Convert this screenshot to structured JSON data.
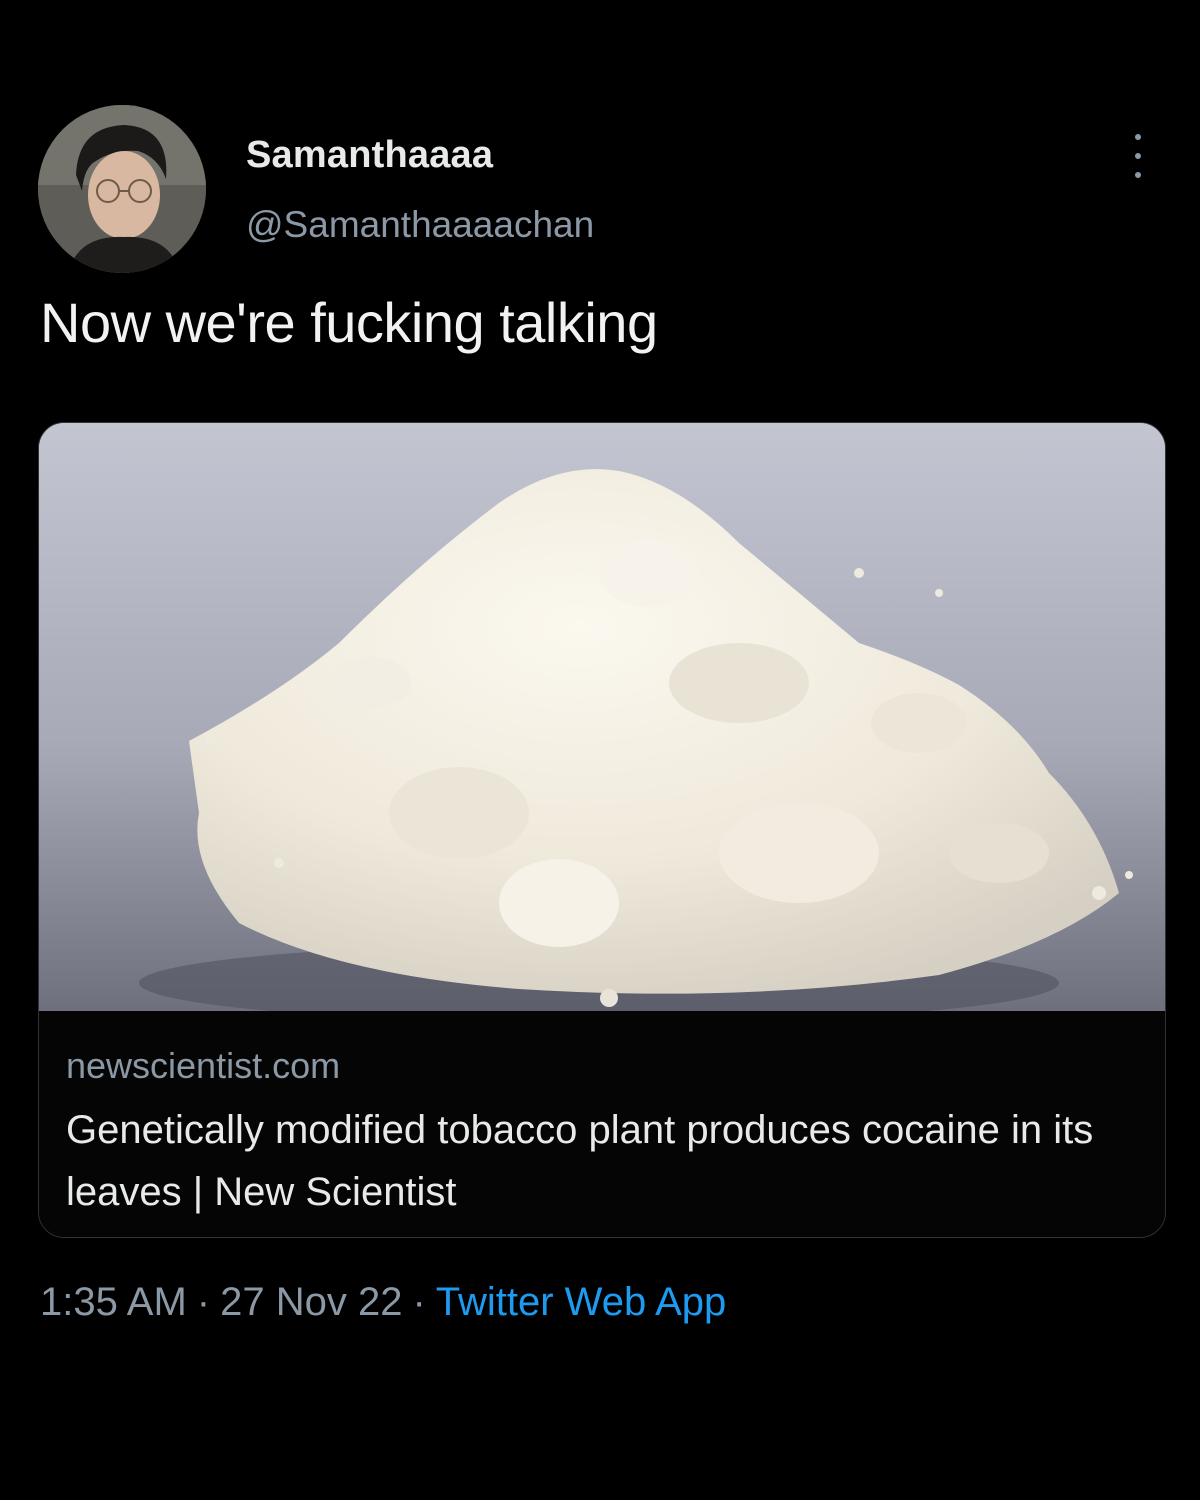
{
  "user": {
    "display_name": "Samanthaaaa",
    "handle": "@Samanthaaaachan",
    "avatar_icon": "user-avatar"
  },
  "tweet": {
    "text": "Now we're fucking talking"
  },
  "link_card": {
    "domain": "newscientist.com",
    "title": "Genetically modified tobacco plant produces cocaine in its leaves | New Scientist",
    "image_icon": "white-powder-pile-image"
  },
  "meta": {
    "time": "1:35 AM",
    "date": "27 Nov 22",
    "separator": "·",
    "source": "Twitter Web App"
  },
  "colors": {
    "background": "#000000",
    "primary_text": "#e7e9ea",
    "secondary_text": "#8b98a5",
    "link_accent": "#1d9bf0",
    "card_border": "#2f3336"
  },
  "icons": {
    "more": "more-options-icon"
  }
}
